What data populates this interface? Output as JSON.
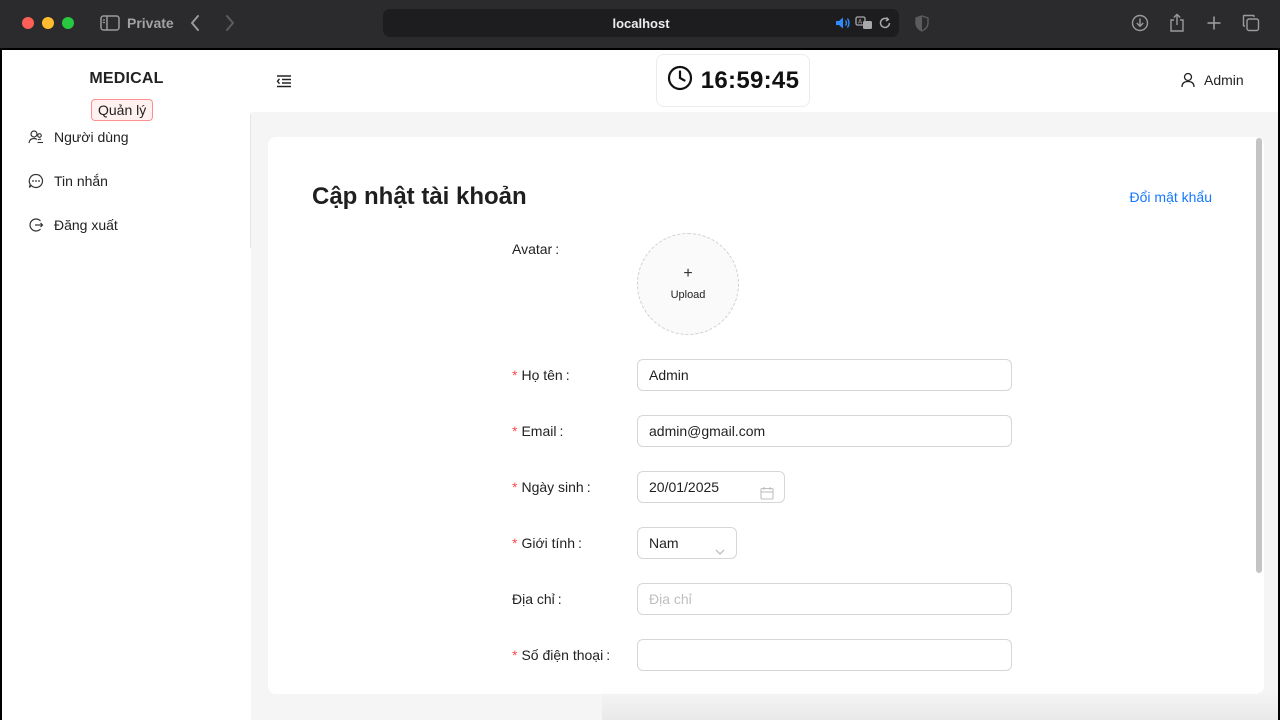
{
  "browser": {
    "private_label": "Private",
    "address_text": "localhost"
  },
  "app": {
    "brand": "MEDICAL",
    "role_tag": "Quản lý",
    "menu": [
      {
        "label": "Người dùng",
        "icon": "users-icon"
      },
      {
        "label": "Tin nhắn",
        "icon": "message-icon"
      },
      {
        "label": "Đăng xuất",
        "icon": "logout-icon"
      }
    ],
    "clock_time": "16:59:45",
    "user_name": "Admin"
  },
  "form": {
    "title": "Cập nhật tài khoản",
    "change_password_link": "Đổi mật khẩu",
    "avatar_label": "Avatar",
    "upload_plus": "+",
    "upload_text": "Upload",
    "fields": {
      "fullname": {
        "label": "Họ tên",
        "value": "Admin"
      },
      "email": {
        "label": "Email",
        "value": "admin@gmail.com"
      },
      "birthday": {
        "label": "Ngày sinh",
        "value": "20/01/2025"
      },
      "gender": {
        "label": "Giới tính",
        "value": "Nam"
      },
      "address": {
        "label": "Địa chỉ",
        "value": "",
        "placeholder": "Địa chỉ"
      },
      "phone": {
        "label": "Số điện thoại",
        "value": ""
      }
    },
    "required_mark": "*",
    "colon": ":"
  },
  "colors": {
    "accent": "#1677ff",
    "required": "#ff4d4f",
    "role_tag_border": "#ff8f8f",
    "role_tag_bg": "#fff1f0"
  }
}
